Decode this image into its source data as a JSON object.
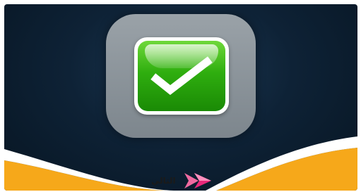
{
  "next": {
    "label": "التالي"
  },
  "icons": {
    "main": "checkmark-icon",
    "next": "double-chevron-right-icon"
  },
  "colors": {
    "background": "#0e2236",
    "tile": "#8a9299",
    "check_green": "#2fae0f",
    "wave_orange": "#f6a81a",
    "next_pink": "#e8287a"
  }
}
